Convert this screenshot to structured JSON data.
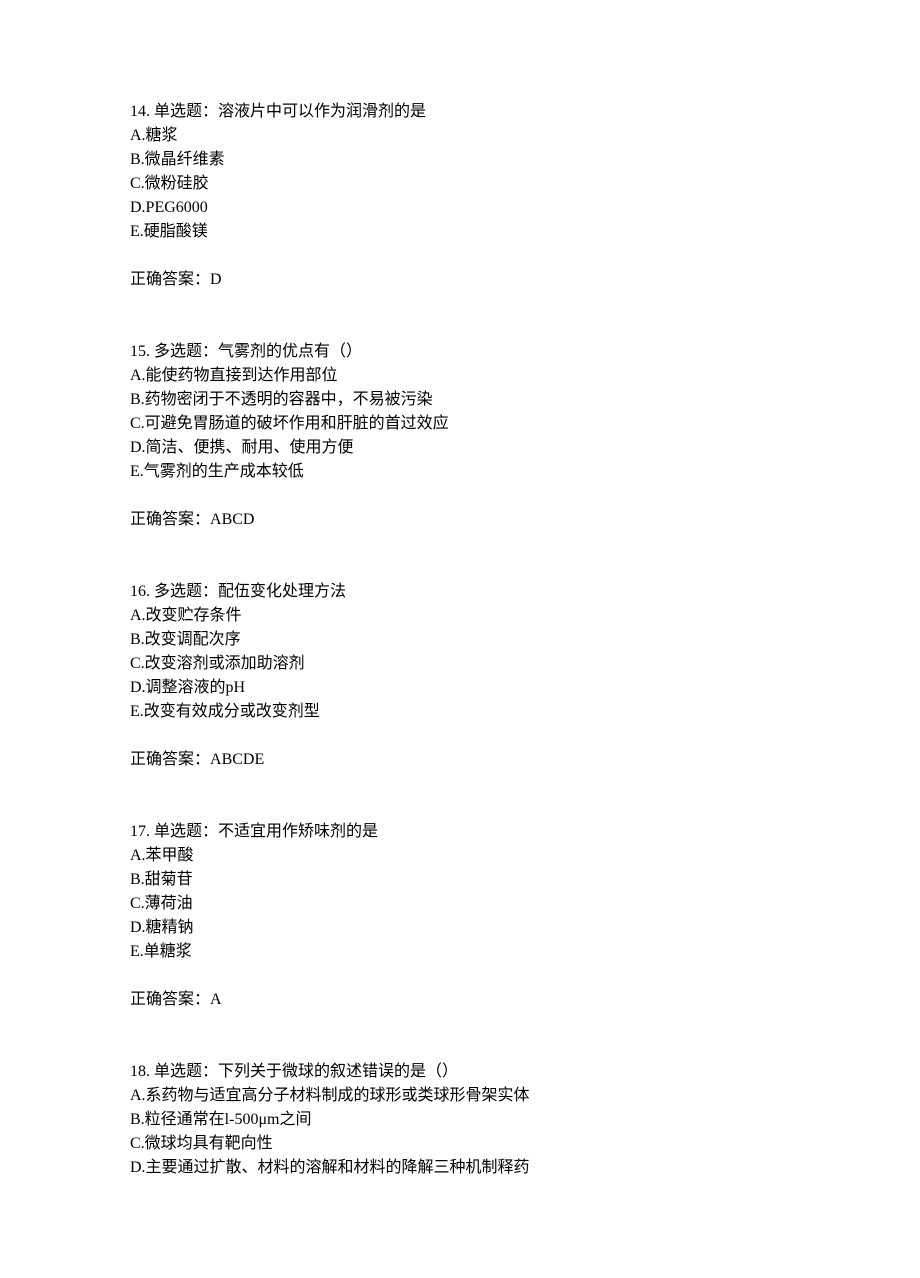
{
  "questions": [
    {
      "number": "14.",
      "type": "单选题：",
      "text": "溶液片中可以作为润滑剂的是",
      "options": [
        "A.糖浆",
        "B.微晶纤维素",
        "C.微粉硅胶",
        "D.PEG6000",
        "E.硬脂酸镁"
      ],
      "answer_label": "正确答案：",
      "answer": "D"
    },
    {
      "number": "15.",
      "type": "多选题：",
      "text": "气雾剂的优点有（）",
      "options": [
        "A.能使药物直接到达作用部位",
        "B.药物密闭于不透明的容器中，不易被污染",
        "C.可避免胃肠道的破坏作用和肝脏的首过效应",
        "D.简洁、便携、耐用、使用方便",
        "E.气雾剂的生产成本较低"
      ],
      "answer_label": "正确答案：",
      "answer": "ABCD"
    },
    {
      "number": "16.",
      "type": "多选题：",
      "text": "配伍变化处理方法",
      "options": [
        "A.改变贮存条件",
        "B.改变调配次序",
        "C.改变溶剂或添加助溶剂",
        "D.调整溶液的pH",
        "E.改变有效成分或改变剂型"
      ],
      "answer_label": "正确答案：",
      "answer": "ABCDE"
    },
    {
      "number": "17.",
      "type": "单选题：",
      "text": "不适宜用作矫味剂的是",
      "options": [
        "A.苯甲酸",
        "B.甜菊苷",
        "C.薄荷油",
        "D.糖精钠",
        "E.单糖浆"
      ],
      "answer_label": "正确答案：",
      "answer": "A"
    },
    {
      "number": "18.",
      "type": "单选题：",
      "text": "下列关于微球的叙述错误的是（）",
      "options": [
        "A.系药物与适宜高分子材料制成的球形或类球形骨架实体",
        "B.粒径通常在l-500μm之间",
        "C.微球均具有靶向性",
        "D.主要通过扩散、材料的溶解和材料的降解三种机制释药"
      ],
      "answer_label": "",
      "answer": ""
    }
  ]
}
